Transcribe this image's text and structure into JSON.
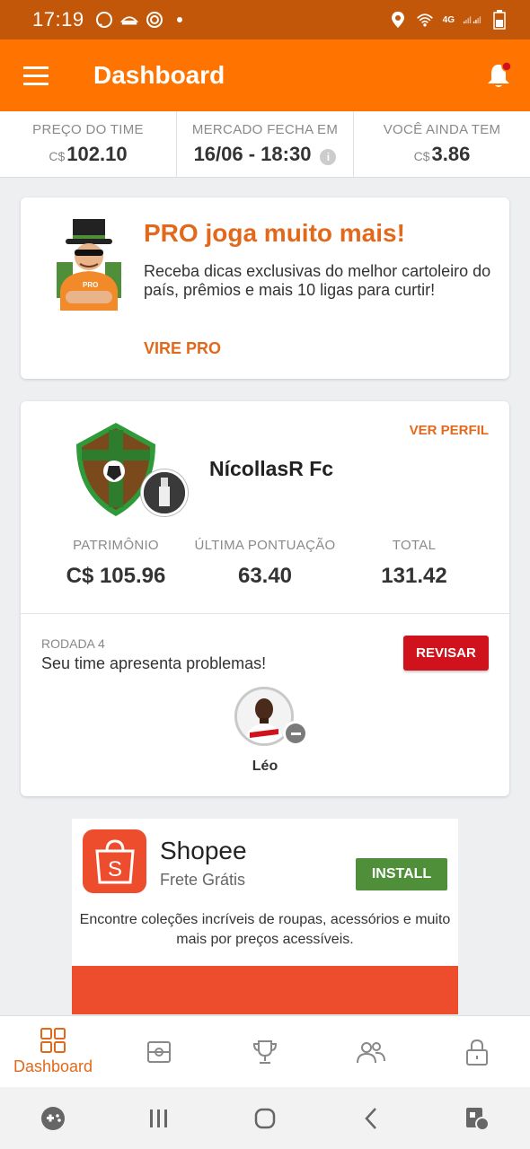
{
  "status_bar": {
    "time": "17:19",
    "network_label": "4G",
    "icons": [
      "whatsapp-icon",
      "notification-icon",
      "app-icon",
      "dot-icon",
      "location-icon",
      "wifi-icon",
      "signal-icon",
      "battery-icon"
    ]
  },
  "app_bar": {
    "title": "Dashboard"
  },
  "info": {
    "price_label": "PREÇO DO TIME",
    "price_currency": "C$",
    "price_value": "102.10",
    "market_label": "MERCADO FECHA EM",
    "market_value": "16/06 - 18:30",
    "market_info": "i",
    "remaining_label": "VOCÊ AINDA TEM",
    "remaining_currency": "C$",
    "remaining_value": "3.86"
  },
  "pro": {
    "title": "PRO joga muito mais!",
    "description": "Receba dicas exclusivas do melhor cartoleiro do país, prêmios e mais 10 ligas para curtir!",
    "link": "VIRE PRO"
  },
  "team": {
    "ver_perfil": "VER PERFIL",
    "name": "NícollasR Fc",
    "stats": [
      {
        "label": "PATRIMÔNIO",
        "value": "C$ 105.96"
      },
      {
        "label": "ÚLTIMA PONTUAÇÃO",
        "value": "63.40"
      },
      {
        "label": "TOTAL",
        "value": "131.42"
      }
    ],
    "round_label": "RODADA 4",
    "problem_text": "Seu time apresenta problemas!",
    "review_button": "REVISAR",
    "player_name": "Léo"
  },
  "ad": {
    "logo_letter": "S",
    "title": "Shopee",
    "subtitle": "Frete Grátis",
    "install_button": "INSTALL",
    "description": "Encontre coleções incríveis de roupas, acessórios e muito mais por preços acessíveis."
  },
  "bottom_nav": {
    "items": [
      {
        "icon": "dashboard-icon",
        "label": "Dashboard",
        "active": true
      },
      {
        "icon": "field-icon",
        "label": ""
      },
      {
        "icon": "trophy-icon",
        "label": ""
      },
      {
        "icon": "people-icon",
        "label": ""
      },
      {
        "icon": "lock-icon",
        "label": ""
      }
    ]
  },
  "colors": {
    "primary": "#ff7300",
    "status_bar": "#c2570a",
    "accent_text": "#e2691c",
    "danger": "#d0121c",
    "ad_install": "#4f8f3a",
    "shopee": "#ee4d2d"
  }
}
